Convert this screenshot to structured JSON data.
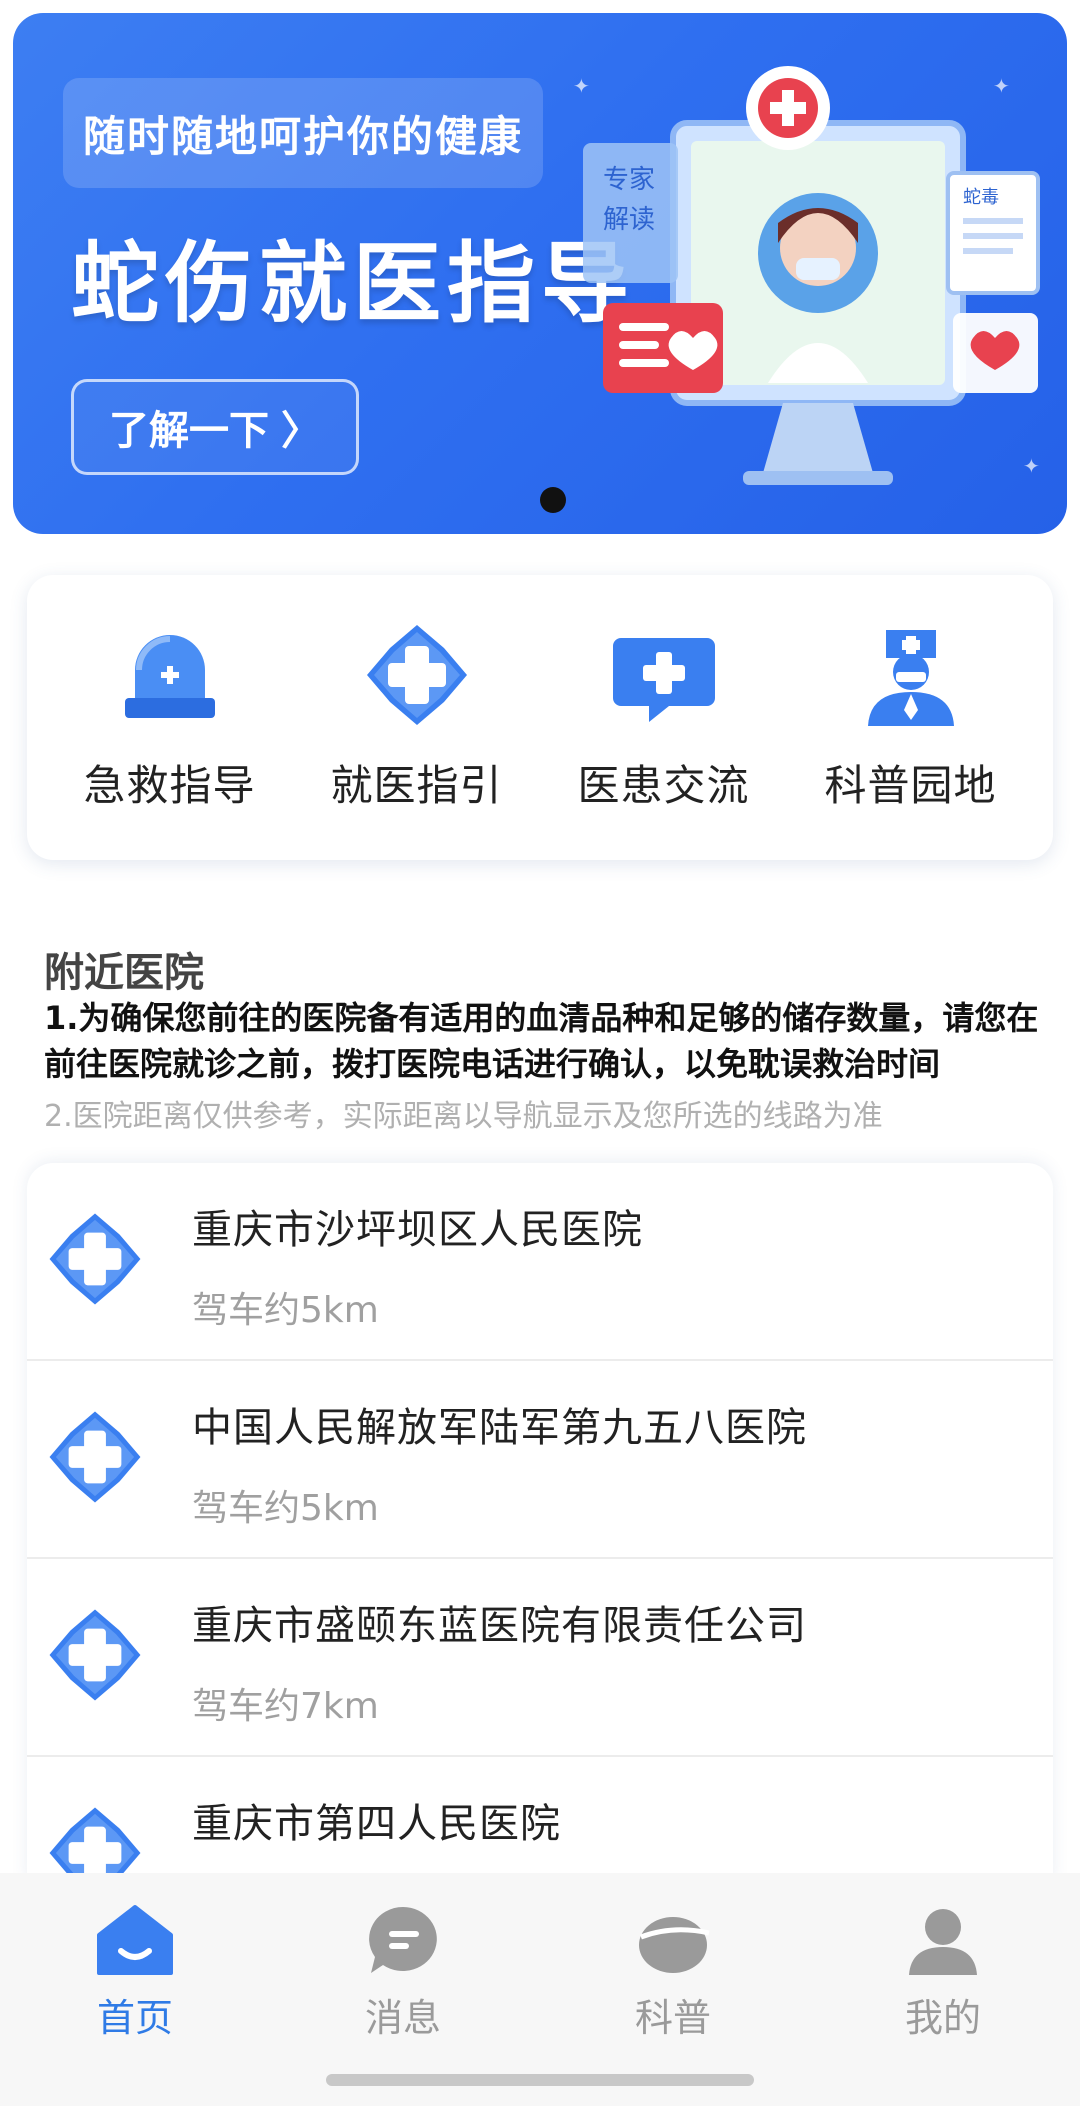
{
  "banner": {
    "tagline": "随时随地呵护你的健康",
    "title": "蛇伤就医指导",
    "button_label": "了解一下",
    "button_chevron": "〉",
    "art_card_text_1": "专家",
    "art_card_text_2": "解读",
    "art_doc_text": "蛇毒"
  },
  "quick_menu": [
    {
      "label": "急救指导",
      "icon": "emergency-light-icon"
    },
    {
      "label": "就医指引",
      "icon": "medical-cross-icon"
    },
    {
      "label": "医患交流",
      "icon": "chat-cross-icon"
    },
    {
      "label": "科普园地",
      "icon": "nurse-icon"
    }
  ],
  "nearby": {
    "title": "附近医院",
    "notice_1": "1.为确保您前往的医院备有适用的血清品种和足够的储存数量，请您在前往医院就诊之前，拨打医院电话进行确认，以免耽误救治时间",
    "notice_2": "2.医院距离仅供参考，实际距离以导航显示及您所选的线路为准"
  },
  "hospitals": [
    {
      "name": "重庆市沙坪坝区人民医院",
      "distance": "驾车约5km"
    },
    {
      "name": "中国人民解放军陆军第九五八医院",
      "distance": "驾车约5km"
    },
    {
      "name": "重庆市盛颐东蓝医院有限责任公司",
      "distance": "驾车约7km"
    },
    {
      "name": "重庆市第四人民医院",
      "distance": ""
    }
  ],
  "bottom_nav": [
    {
      "label": "首页",
      "icon": "home-icon",
      "active": true
    },
    {
      "label": "消息",
      "icon": "message-icon",
      "active": false
    },
    {
      "label": "科普",
      "icon": "science-icon",
      "active": false
    },
    {
      "label": "我的",
      "icon": "profile-icon",
      "active": false
    }
  ],
  "colors": {
    "accent": "#2f7be6",
    "banner_bg": "#2f6ff0",
    "icon_blue": "#3a7ff0"
  }
}
